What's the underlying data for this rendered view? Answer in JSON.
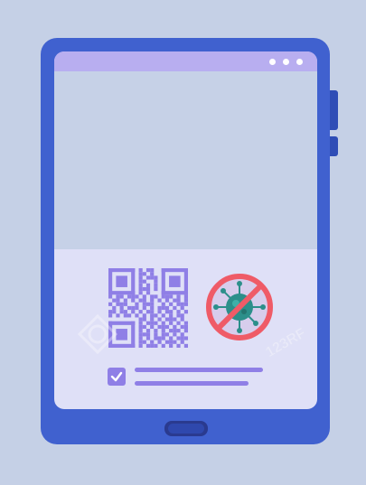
{
  "colors": {
    "background": "#c5d0e6",
    "tablet_frame": "#4061cf",
    "screen": "#dfe0f7",
    "titlebar": "#b8aef0",
    "viewport": "#c6d1e7",
    "accent_purple": "#8f7fe6",
    "virus_green": "#2c8f8a",
    "prohibition_red": "#ef5b67"
  },
  "window": {
    "controls": [
      "dot",
      "dot",
      "dot"
    ]
  },
  "content": {
    "qr_icon": "qr-code-icon",
    "virus_icon": "no-virus-icon",
    "check_icon": "checkbox-checked-icon"
  },
  "watermark": {
    "text": "123RF"
  }
}
